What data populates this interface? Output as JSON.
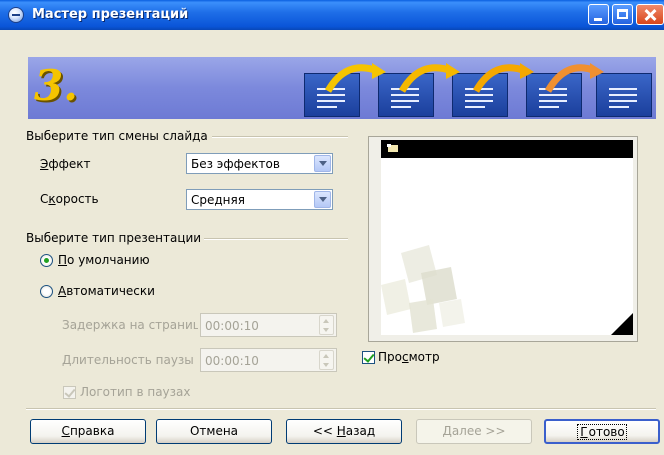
{
  "window": {
    "title": "Мастер презентаций",
    "step_number": "3."
  },
  "transition": {
    "group_label": "Выберите тип смены слайда",
    "effect_label": "Эффект",
    "effect_value": "Без эффектов",
    "speed_label": "Скорость",
    "speed_value": "Средняя"
  },
  "presentation": {
    "group_label": "Выберите тип презентации",
    "default_option": "По умолчанию",
    "auto_option": "Автоматически",
    "delay_label": "Задержка на страниц",
    "delay_value": "00:00:10",
    "pause_label": "Длительность паузы",
    "pause_value": "00:00:10",
    "logo_label": "Логотип в паузах",
    "selected": "default"
  },
  "preview": {
    "label": "Просмотр",
    "checked": true
  },
  "buttons": {
    "help": "Справка",
    "cancel": "Отмена",
    "back": "<< Назад",
    "next": "Далее >>",
    "finish": "Готово"
  },
  "colors": {
    "titlebar": "#0a55d8",
    "banner": "#7c89dc",
    "step_number": "#f5c400",
    "radio_dot": "#21a121"
  }
}
